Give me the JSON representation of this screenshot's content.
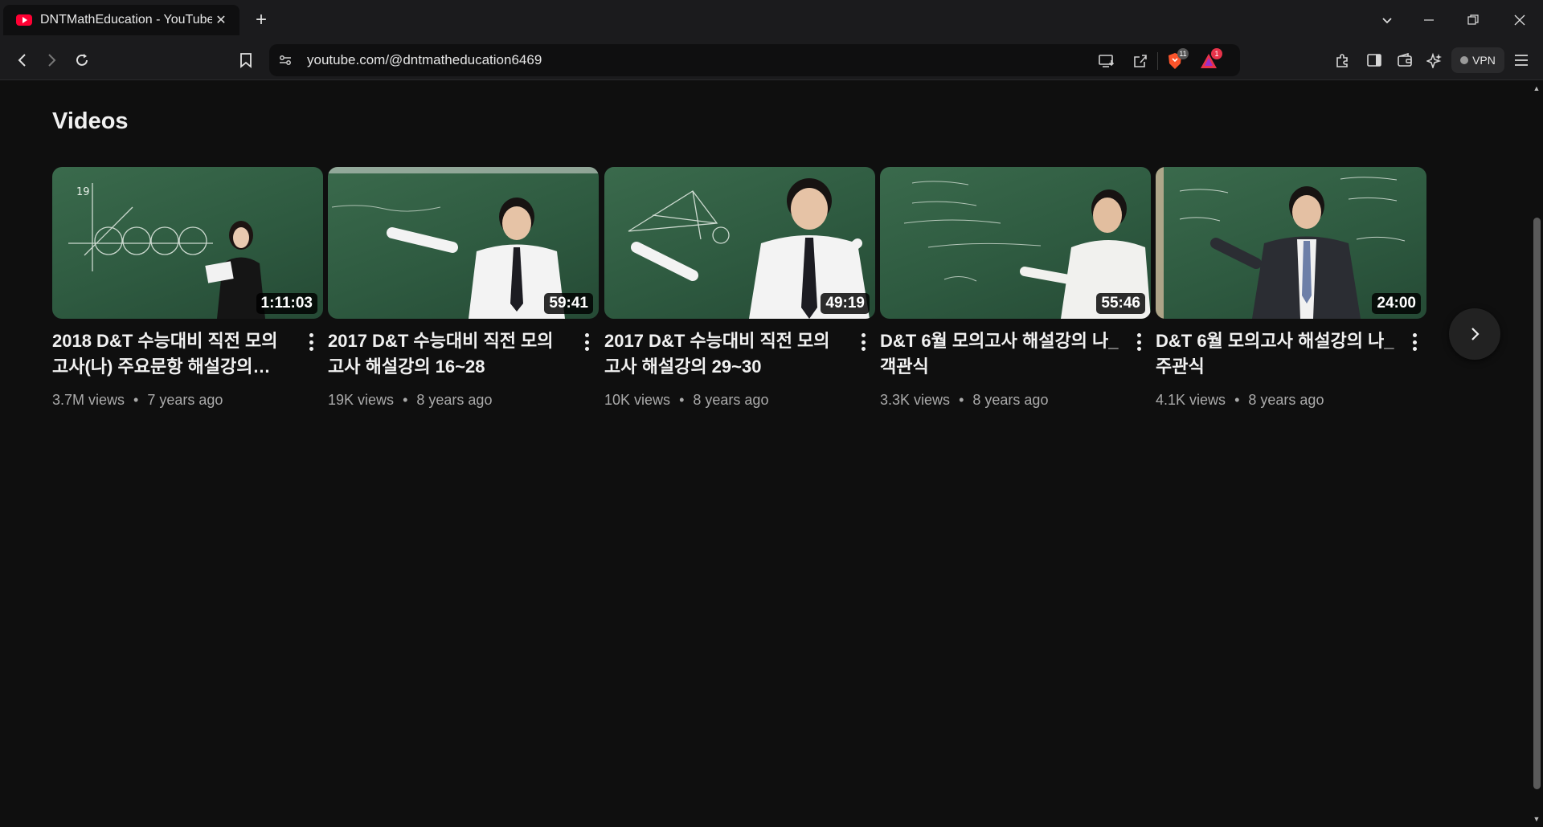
{
  "browser": {
    "tab": {
      "title": "DNTMathEducation - YouTube",
      "close": "✕"
    },
    "new_tab": "+",
    "url": "youtube.com/@dntmatheducation6469",
    "shields_badge": "11",
    "rewards_badge": "1",
    "vpn_label": "VPN"
  },
  "section": {
    "title": "Videos"
  },
  "videos": [
    {
      "title": "2018 D&T 수능대비 직전 모의고사(나) 주요문항 해설강의…",
      "duration": "1:11:03",
      "views": "3.7M views",
      "age": "7 years ago"
    },
    {
      "title": "2017 D&T 수능대비 직전 모의고사 해설강의 16~28",
      "duration": "59:41",
      "views": "19K views",
      "age": "8 years ago"
    },
    {
      "title": "2017 D&T 수능대비 직전 모의고사 해설강의 29~30",
      "duration": "49:19",
      "views": "10K views",
      "age": "8 years ago"
    },
    {
      "title": "D&T 6월 모의고사 해설강의 나_객관식",
      "duration": "55:46",
      "views": "3.3K views",
      "age": "8 years ago"
    },
    {
      "title": "D&T 6월 모의고사 해설강의 나_주관식",
      "duration": "24:00",
      "views": "4.1K views",
      "age": "8 years ago"
    }
  ],
  "meta_separator": "•",
  "colors": {
    "background": "#0f0f0f",
    "chalkboard": "#2e5a40",
    "youtube_red": "#ff0033",
    "brave_orange": "#fb542b"
  }
}
